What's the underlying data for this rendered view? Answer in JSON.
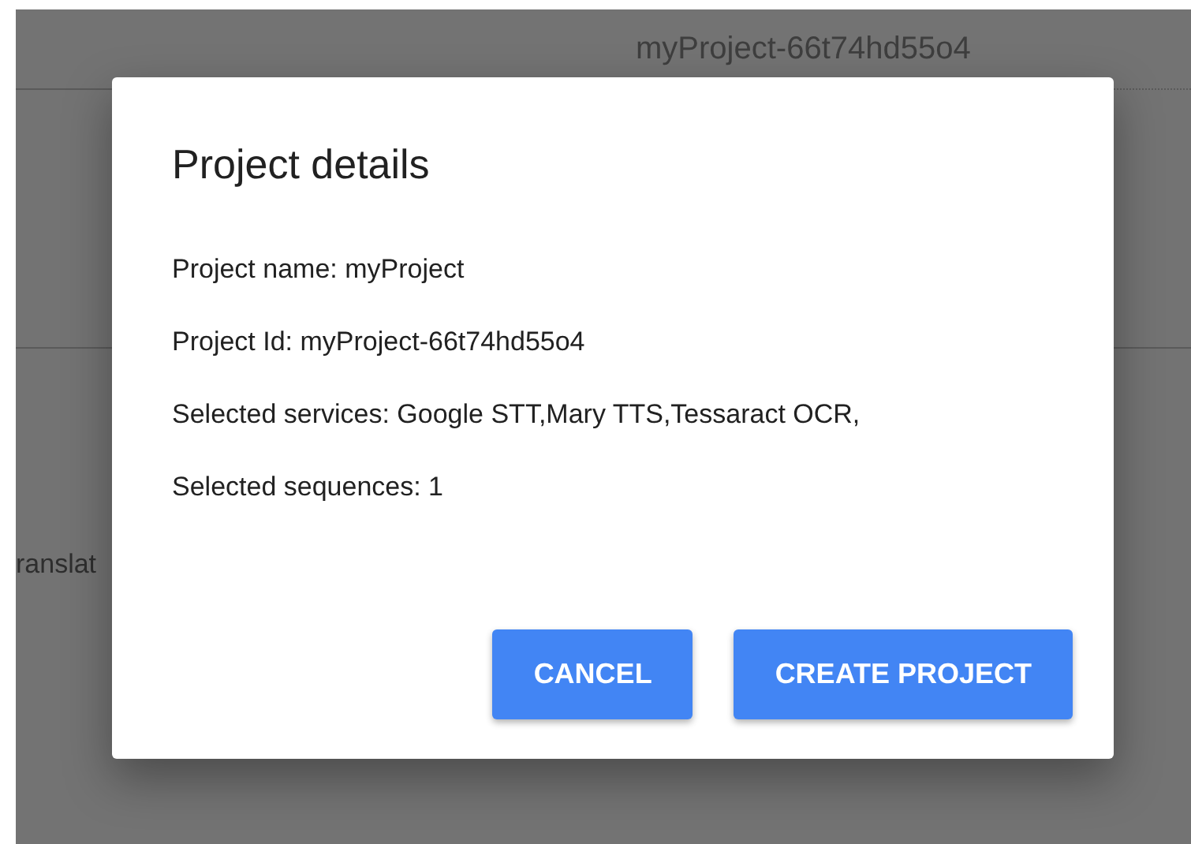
{
  "background": {
    "project_id": "myProject-66t74hd55o4",
    "partial_label": "ranslat"
  },
  "dialog": {
    "title": "Project details",
    "details": [
      "Project name: myProject",
      "Project Id: myProject-66t74hd55o4",
      "Selected services: Google STT,Mary TTS,Tessaract OCR,",
      "Selected sequences: 1"
    ],
    "buttons": [
      {
        "label": "CANCEL"
      },
      {
        "label": "CREATE PROJECT"
      }
    ]
  }
}
